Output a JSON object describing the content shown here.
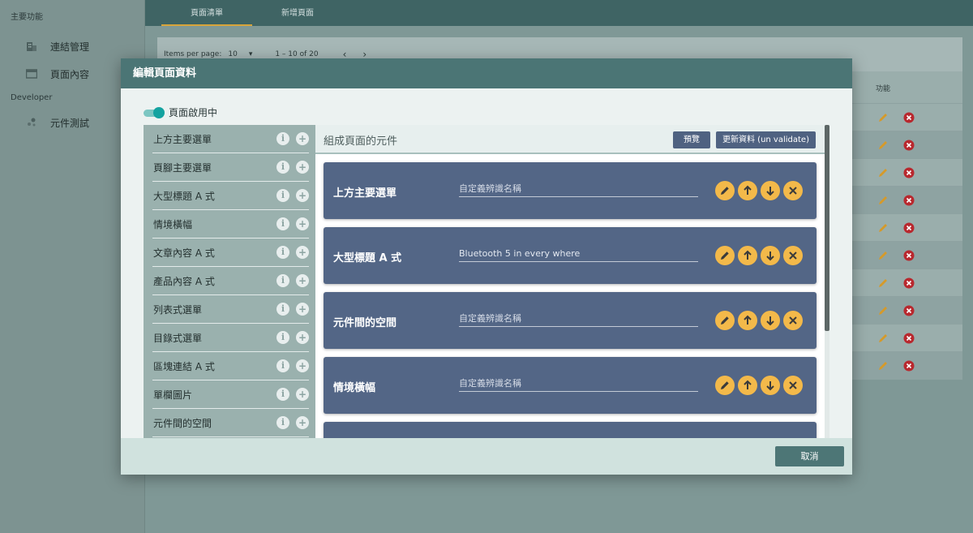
{
  "sidebar": {
    "section_main": "主要功能",
    "items": [
      {
        "label": "連結管理",
        "icon": "building-icon"
      },
      {
        "label": "頁面內容",
        "icon": "window-icon"
      }
    ],
    "section_dev": "Developer",
    "dev_items": [
      {
        "label": "元件測試",
        "icon": "component-icon"
      }
    ]
  },
  "topbar": {
    "tabs": [
      "頁面清單",
      "新增頁面"
    ]
  },
  "pager": {
    "items_per_page_label": "Items per page:",
    "items_per_page_value": "10",
    "range": "1 – 10 of 20"
  },
  "table": {
    "func_header": "功能",
    "row_count": 10
  },
  "modal": {
    "title": "編輯頁面資料",
    "toggle_label": "頁面啟用中",
    "left_items": [
      "上方主要選單",
      "頁腳主要選單",
      "大型標題 A 式",
      "情境橫幅",
      "文章內容 A 式",
      "產品內容 A 式",
      "列表式選單",
      "目錄式選單",
      "區塊連結 A 式",
      "單欄圖片",
      "元件間的空間"
    ],
    "right_title": "組成頁面的元件",
    "preview_label": "預覽",
    "update_label": "更新資料 (un validate)",
    "components": [
      {
        "name": "上方主要選單",
        "value": "",
        "placeholder": "自定義辨識名稱"
      },
      {
        "name": "大型標題 A 式",
        "value": "Bluetooth 5 in every where",
        "placeholder": "自定義辨識名稱"
      },
      {
        "name": "元件間的空間",
        "value": "",
        "placeholder": "自定義辨識名稱"
      },
      {
        "name": "情境橫幅",
        "value": "",
        "placeholder": "自定義辨識名稱"
      }
    ],
    "cancel_label": "取消"
  },
  "colors": {
    "header": "#4b7575",
    "card": "#536686",
    "action": "#f3b94a",
    "toggle": "#14a3a0"
  }
}
